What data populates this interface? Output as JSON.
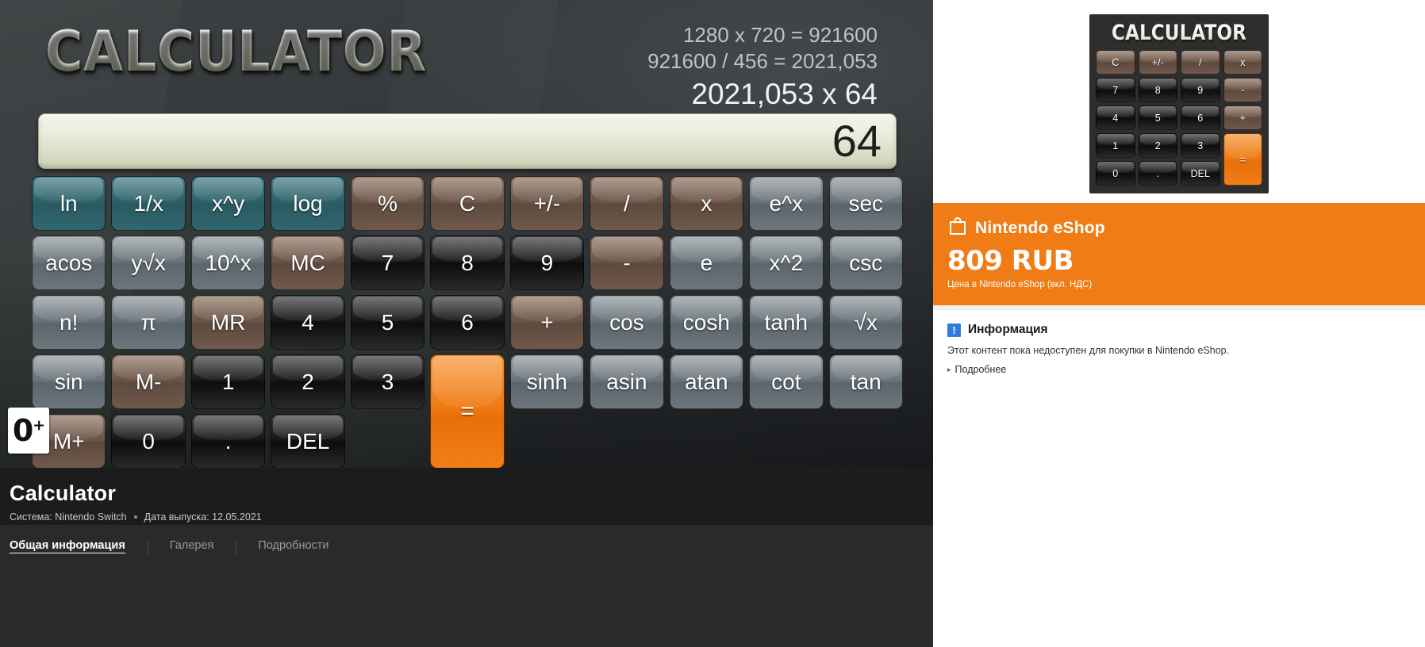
{
  "hero": {
    "title": "CALCULATOR",
    "calc_lines": {
      "line1": "1280 x 720 = 921600",
      "line2": "921600 / 456 = 2021,053",
      "line3": "2021,053 x 64"
    },
    "display_value": "64",
    "age_rating": "0",
    "age_rating_sup": "+",
    "keys": [
      {
        "label": "ln",
        "style": "teal"
      },
      {
        "label": "1/x",
        "style": "teal"
      },
      {
        "label": "x^y",
        "style": "teal"
      },
      {
        "label": "log",
        "style": "teal"
      },
      {
        "label": "%",
        "style": "brown"
      },
      {
        "label": "C",
        "style": "brown"
      },
      {
        "label": "+/-",
        "style": "brown"
      },
      {
        "label": "/",
        "style": "brown"
      },
      {
        "label": "x",
        "style": "brown"
      },
      {
        "label": "e^x",
        "style": "grey"
      },
      {
        "label": "sec",
        "style": "grey"
      },
      {
        "label": "acos",
        "style": "grey"
      },
      {
        "label": "y√x",
        "style": "grey"
      },
      {
        "label": "10^x",
        "style": "grey"
      },
      {
        "label": "MC",
        "style": "brown"
      },
      {
        "label": "7",
        "style": "dark"
      },
      {
        "label": "8",
        "style": "dark"
      },
      {
        "label": "9",
        "style": "dark"
      },
      {
        "label": "-",
        "style": "brown"
      },
      {
        "label": "e",
        "style": "grey"
      },
      {
        "label": "x^2",
        "style": "grey"
      },
      {
        "label": "csc",
        "style": "grey"
      },
      {
        "label": "n!",
        "style": "grey"
      },
      {
        "label": "π",
        "style": "grey"
      },
      {
        "label": "MR",
        "style": "brown"
      },
      {
        "label": "4",
        "style": "dark"
      },
      {
        "label": "5",
        "style": "dark"
      },
      {
        "label": "6",
        "style": "dark"
      },
      {
        "label": "+",
        "style": "brown"
      },
      {
        "label": "cos",
        "style": "grey"
      },
      {
        "label": "cosh",
        "style": "grey"
      },
      {
        "label": "tanh",
        "style": "grey"
      },
      {
        "label": "√x",
        "style": "grey"
      },
      {
        "label": "sin",
        "style": "grey"
      },
      {
        "label": "M-",
        "style": "brown"
      },
      {
        "label": "1",
        "style": "dark"
      },
      {
        "label": "2",
        "style": "dark"
      },
      {
        "label": "3",
        "style": "dark"
      },
      {
        "label": "=",
        "style": "orange equals"
      },
      {
        "label": "sinh",
        "style": "grey"
      },
      {
        "label": "asin",
        "style": "grey"
      },
      {
        "label": "atan",
        "style": "grey"
      },
      {
        "label": "cot",
        "style": "grey"
      },
      {
        "label": "tan",
        "style": "grey"
      },
      {
        "label": "M+",
        "style": "brown"
      },
      {
        "label": "0",
        "style": "dark"
      },
      {
        "label": ".",
        "style": "dark"
      },
      {
        "label": "DEL",
        "style": "dark"
      }
    ]
  },
  "product": {
    "title": "Calculator",
    "system_label": "Система: Nintendo Switch",
    "release_label": "Дата выпуска: 12.05.2021"
  },
  "tabs": [
    {
      "label": "Общая информация",
      "active": true
    },
    {
      "label": "Галерея",
      "active": false
    },
    {
      "label": "Подробности",
      "active": false
    }
  ],
  "boxart": {
    "title": "CALCULATOR",
    "keys": [
      {
        "label": "C",
        "style": "brown"
      },
      {
        "label": "+/-",
        "style": "brown"
      },
      {
        "label": "/",
        "style": "brown"
      },
      {
        "label": "x",
        "style": "brown"
      },
      {
        "label": "7",
        "style": "dark"
      },
      {
        "label": "8",
        "style": "dark"
      },
      {
        "label": "9",
        "style": "dark"
      },
      {
        "label": "-",
        "style": "brown"
      },
      {
        "label": "4",
        "style": "dark"
      },
      {
        "label": "5",
        "style": "dark"
      },
      {
        "label": "6",
        "style": "dark"
      },
      {
        "label": "+",
        "style": "brown"
      },
      {
        "label": "1",
        "style": "dark"
      },
      {
        "label": "2",
        "style": "dark"
      },
      {
        "label": "3",
        "style": "dark"
      },
      {
        "label": "=",
        "style": "orange tall"
      },
      {
        "label": "0",
        "style": "dark"
      },
      {
        "label": ".",
        "style": "dark"
      },
      {
        "label": "DEL",
        "style": "dark"
      }
    ]
  },
  "price": {
    "shop_name": "Nintendo eShop",
    "amount": "809 RUB",
    "note": "Цена в Nintendo eShop (вкл. НДС)",
    "accent_color": "#f07c16"
  },
  "info": {
    "icon_glyph": "!",
    "title": "Информация",
    "text": "Этот контент пока недоступен для покупки в Nintendo eShop.",
    "more_label": "Подробнее",
    "caret": "▸"
  }
}
